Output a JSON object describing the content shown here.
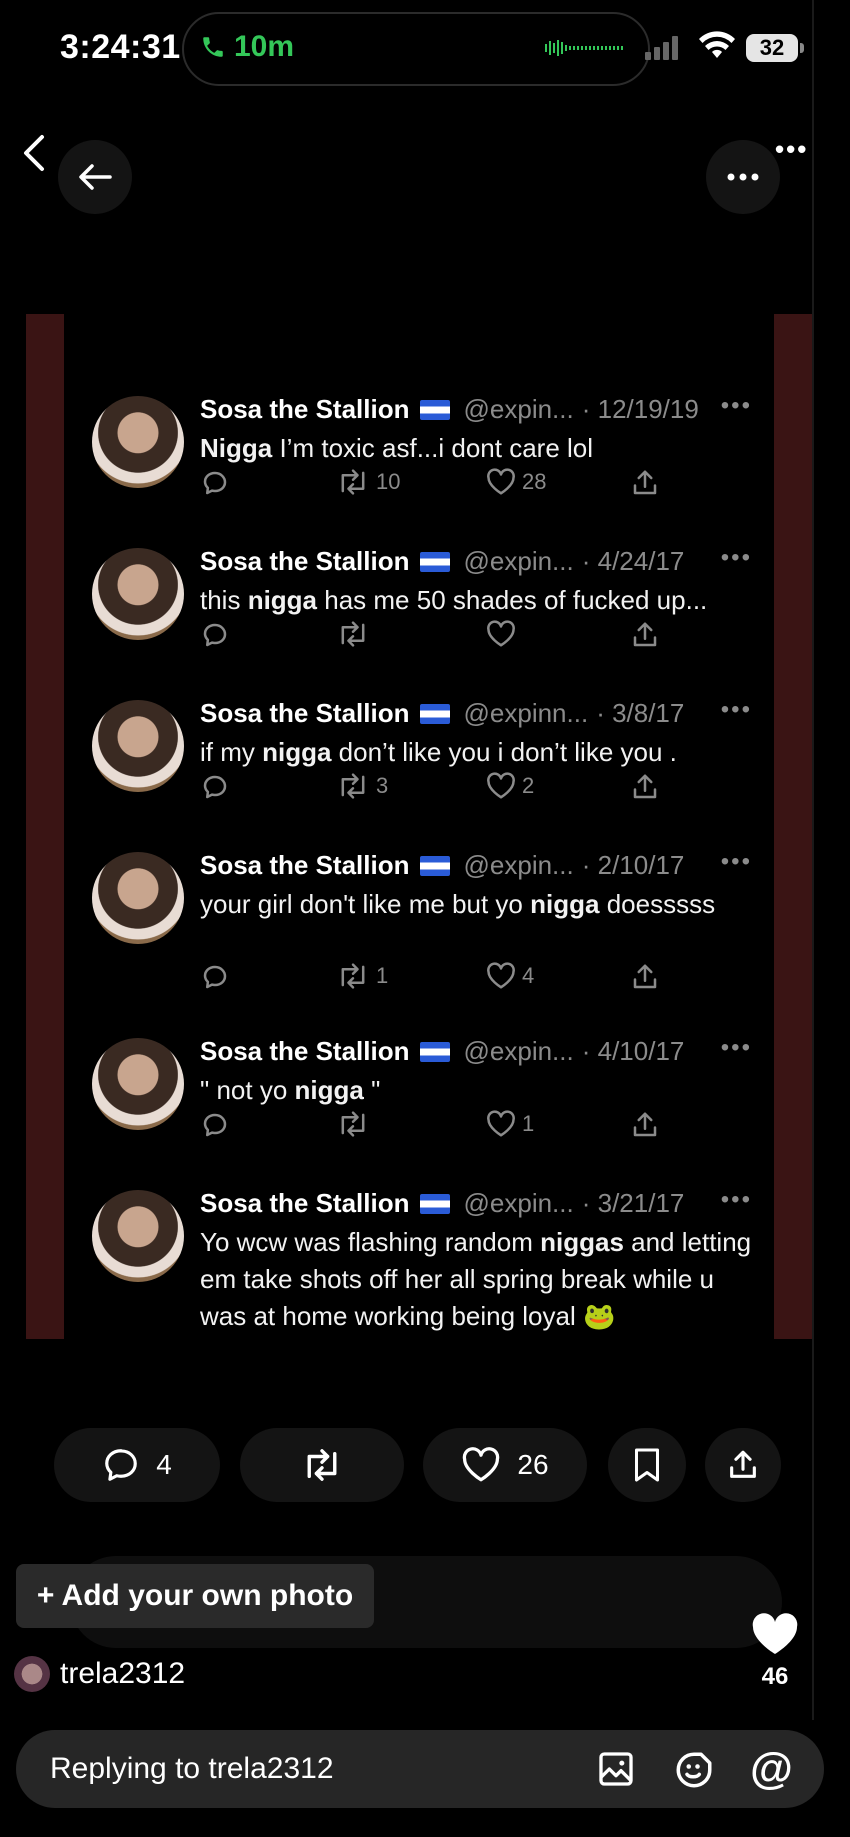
{
  "status": {
    "time": "3:24:31",
    "call_duration": "10m",
    "battery": "32"
  },
  "tweets": [
    {
      "name": "Sosa the Stallion",
      "handle": "@expin...",
      "date": "· 12/19/19",
      "text_before": "",
      "bold": "Nigga",
      "text_after": " I’m toxic asf...i dont care lol",
      "replies": "",
      "retweets": "10",
      "likes": "28"
    },
    {
      "name": "Sosa the Stallion",
      "handle": "@expin...",
      "date": "· 4/24/17",
      "text_before": "this ",
      "bold": "nigga",
      "text_after": " has me 50 shades of fucked up...",
      "replies": "",
      "retweets": "",
      "likes": ""
    },
    {
      "name": "Sosa the Stallion",
      "handle": "@expinn...",
      "date": "· 3/8/17",
      "text_before": "if my ",
      "bold": "nigga",
      "text_after": " don’t like you i don’t like you .",
      "replies": "",
      "retweets": "3",
      "likes": "2"
    },
    {
      "name": "Sosa the Stallion",
      "handle": "@expin...",
      "date": "· 2/10/17",
      "text_before": "your girl don't like me but yo ",
      "bold": "nigga",
      "text_after": " doesssss",
      "replies": "",
      "retweets": "1",
      "likes": "4"
    },
    {
      "name": "Sosa the Stallion",
      "handle": "@expin...",
      "date": "· 4/10/17",
      "text_before": "\" not yo ",
      "bold": "nigga",
      "text_after": " \"",
      "replies": "",
      "retweets": "",
      "likes": "1"
    },
    {
      "name": "Sosa the Stallion",
      "handle": "@expin...",
      "date": "· 3/21/17",
      "text_before": "Yo wcw was flashing random ",
      "bold": "niggas",
      "text_after": " and letting em take shots off her all spring break while u was at home working being loyal 🐸",
      "replies": "",
      "retweets": "",
      "likes": ""
    }
  ],
  "action_bar": {
    "comments": "4",
    "likes": "26"
  },
  "add_photo_label": "+ Add your own photo",
  "username": "trela2312",
  "like_count": "46",
  "reply_placeholder": "Replying to trela2312",
  "icons": [
    "back-chevron-icon",
    "back-arrow-icon",
    "more-icon",
    "comment-icon",
    "retweet-icon",
    "heart-icon",
    "share-icon",
    "bookmark-icon",
    "gallery-icon",
    "sticker-icon",
    "mention-icon"
  ]
}
